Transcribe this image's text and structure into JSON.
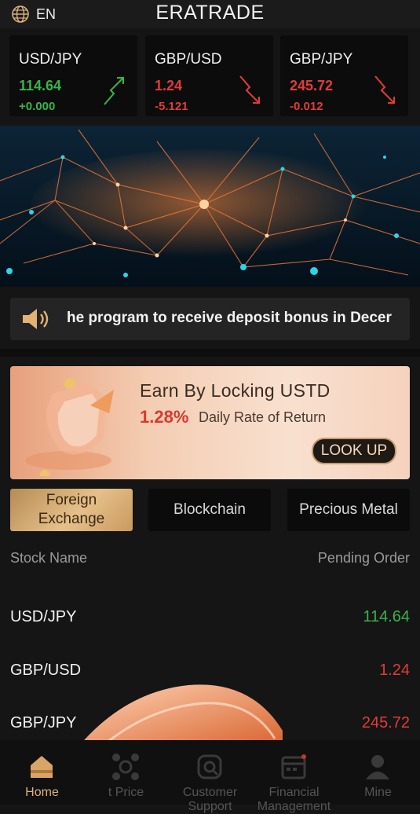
{
  "header": {
    "language": "EN",
    "title": "ERATRADE"
  },
  "quotes": [
    {
      "pair": "USD/JPY",
      "price": "114.64",
      "change": "+0.000",
      "direction": "up"
    },
    {
      "pair": "GBP/USD",
      "price": "1.24",
      "change": "-5.121",
      "direction": "down"
    },
    {
      "pair": "GBP/JPY",
      "price": "245.72",
      "change": "-0.012",
      "direction": "down"
    }
  ],
  "notice": {
    "text": "he program to receive deposit bonus in Decer"
  },
  "promo": {
    "title": "Earn By Locking USTD",
    "rate": "1.28%",
    "rate_label": "Daily Rate of Return",
    "button": "LOOK UP"
  },
  "tabs": [
    {
      "label": "Foreign Exchange",
      "active": true
    },
    {
      "label": "Blockchain",
      "active": false
    },
    {
      "label": "Precious Metal",
      "active": false
    }
  ],
  "list": {
    "col_name": "Stock Name",
    "col_value": "Pending Order",
    "rows": [
      {
        "name": "USD/JPY",
        "value": "114.64",
        "direction": "up"
      },
      {
        "name": "GBP/USD",
        "value": "1.24",
        "direction": "down"
      },
      {
        "name": "GBP/JPY",
        "value": "245.72",
        "direction": "down"
      }
    ]
  },
  "nav": [
    {
      "label": "Home",
      "icon": "home-icon",
      "active": true
    },
    {
      "label": "t Price",
      "icon": "market-icon",
      "active": false
    },
    {
      "label": "Customer Support",
      "icon": "support-icon",
      "active": false
    },
    {
      "label": "Financial Management",
      "icon": "finance-icon",
      "active": false
    },
    {
      "label": "Mine",
      "icon": "user-icon",
      "active": false
    }
  ],
  "colors": {
    "up": "#39b34a",
    "down": "#e23b3b",
    "accent": "#e0b27a",
    "background": "#151515"
  }
}
